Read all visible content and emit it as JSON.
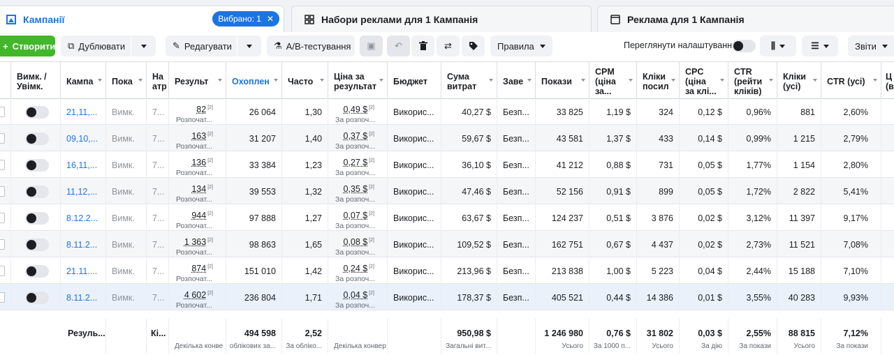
{
  "tabs": {
    "campaigns": "Кампанії",
    "selected_badge": "Вибрано: 1",
    "adsets": "Набори реклами для 1 Кампанія",
    "ads": "Реклама для 1 Кампанія"
  },
  "toolbar": {
    "create": "Створити",
    "duplicate": "Дублювати",
    "edit": "Редагувати",
    "ab_test": "А/В-тестування",
    "rules": "Правила",
    "view_settings": "Переглянути налаштування",
    "reports": "Звіти"
  },
  "columns": [
    "Вимк. / Увімк.",
    "Кампа",
    "Пока",
    "На атр",
    "Результ",
    "Охоплен",
    "Часто",
    "Ціна за результат",
    "Бюджет",
    "Сума витрат",
    "Заве",
    "Покази",
    "CPM (ціна за...",
    "Кліки посил",
    "CPC (ціна за клі...",
    "CTR (рейти кліків)",
    "Кліки (усі)",
    "CTR (усі)",
    "Ц (в"
  ],
  "rows": [
    {
      "name": "21,11,...",
      "delivery": "Вимк.",
      "attr": "7...",
      "result": "82",
      "result_sub": "Розпочат...",
      "reach": "26 064",
      "freq": "1,30",
      "cpr": "0,49 $",
      "cpr_sub": "За розпоч...",
      "budget": "Викорис...",
      "spent": "40,27 $",
      "end": "Безп...",
      "impr": "33 825",
      "cpm": "1,19 $",
      "link": "324",
      "cpc": "0,12 $",
      "ctr": "0,96%",
      "clicks": "881",
      "ctr_all": "2,60%"
    },
    {
      "name": "09,10,...",
      "delivery": "Вимк.",
      "attr": "7...",
      "result": "163",
      "result_sub": "Розпочат...",
      "reach": "31 207",
      "freq": "1,40",
      "cpr": "0,37 $",
      "cpr_sub": "За розпоч...",
      "budget": "Викорис...",
      "spent": "59,67 $",
      "end": "Безп...",
      "impr": "43 581",
      "cpm": "1,37 $",
      "link": "433",
      "cpc": "0,14 $",
      "ctr": "0,99%",
      "clicks": "1 215",
      "ctr_all": "2,79%"
    },
    {
      "name": "16,11,...",
      "delivery": "Вимк.",
      "attr": "7...",
      "result": "136",
      "result_sub": "Розпочат...",
      "reach": "33 384",
      "freq": "1,23",
      "cpr": "0,27 $",
      "cpr_sub": "За розпоч...",
      "budget": "Викорис...",
      "spent": "36,10 $",
      "end": "Безп...",
      "impr": "41 212",
      "cpm": "0,88 $",
      "link": "731",
      "cpc": "0,05 $",
      "ctr": "1,77%",
      "clicks": "1 154",
      "ctr_all": "2,80%"
    },
    {
      "name": "11,12,...",
      "delivery": "Вимк.",
      "attr": "7...",
      "result": "134",
      "result_sub": "Розпочат...",
      "reach": "39 553",
      "freq": "1,32",
      "cpr": "0,35 $",
      "cpr_sub": "За розпоч...",
      "budget": "Викорис...",
      "spent": "47,46 $",
      "end": "Безп...",
      "impr": "52 156",
      "cpm": "0,91 $",
      "link": "899",
      "cpc": "0,05 $",
      "ctr": "1,72%",
      "clicks": "2 822",
      "ctr_all": "5,41%"
    },
    {
      "name": "8.12.2...",
      "delivery": "Вимк.",
      "attr": "7...",
      "result": "944",
      "result_sub": "Розпочат...",
      "reach": "97 888",
      "freq": "1,27",
      "cpr": "0,07 $",
      "cpr_sub": "За розпоч...",
      "budget": "Викорис...",
      "spent": "63,67 $",
      "end": "Безп...",
      "impr": "124 237",
      "cpm": "0,51 $",
      "link": "3 876",
      "cpc": "0,02 $",
      "ctr": "3,12%",
      "clicks": "11 397",
      "ctr_all": "9,17%"
    },
    {
      "name": "8.11.2...",
      "delivery": "Вимк.",
      "attr": "7...",
      "result": "1 363",
      "result_sub": "Розпочат...",
      "reach": "98 863",
      "freq": "1,65",
      "cpr": "0,08 $",
      "cpr_sub": "За розпоч...",
      "budget": "Викорис...",
      "spent": "109,52 $",
      "end": "Безп...",
      "impr": "162 751",
      "cpm": "0,67 $",
      "link": "4 437",
      "cpc": "0,02 $",
      "ctr": "2,73%",
      "clicks": "11 521",
      "ctr_all": "7,08%"
    },
    {
      "name": "21.11....",
      "delivery": "Вимк.",
      "attr": "7...",
      "result": "874",
      "result_sub": "Розпочат...",
      "reach": "151 010",
      "freq": "1,42",
      "cpr": "0,24 $",
      "cpr_sub": "За розпоч...",
      "budget": "Викорис...",
      "spent": "213,96 $",
      "end": "Безп...",
      "impr": "213 838",
      "cpm": "1,00 $",
      "link": "5 223",
      "cpc": "0,04 $",
      "ctr": "2,44%",
      "clicks": "15 188",
      "ctr_all": "7,10%"
    },
    {
      "name": "8.11.2...",
      "delivery": "Вимк.",
      "attr": "7...",
      "result": "4 602",
      "result_sub": "Розпочат...",
      "reach": "236 804",
      "freq": "1,71",
      "cpr": "0,04 $",
      "cpr_sub": "За розпоч...",
      "budget": "Викорис...",
      "spent": "178,37 $",
      "end": "Безп...",
      "impr": "405 521",
      "cpm": "0,44 $",
      "link": "14 386",
      "cpc": "0,01 $",
      "ctr": "3,55%",
      "clicks": "40 283",
      "ctr_all": "9,93%"
    }
  ],
  "totals": {
    "label": "Резуль...",
    "attr": "Кі...",
    "result_sub": "Декілька конве",
    "reach": "494 598",
    "reach_sub": "облікових за...",
    "freq": "2,52",
    "freq_sub": "За обліко...",
    "cpr_sub": "Декілька конвер",
    "spent": "950,98 $",
    "spent_sub": "Загальні вит...",
    "impr": "1 246 980",
    "impr_sub": "Усього",
    "cpm": "0,76 $",
    "cpm_sub": "За 1000 п...",
    "link": "31 802",
    "link_sub": "Усього",
    "cpc": "0,03 $",
    "cpc_sub": "За дію",
    "ctr": "2,55%",
    "ctr_sub": "За покази",
    "clicks": "88 815",
    "clicks_sub": "Усього",
    "ctr_all": "7,12%",
    "ctr_all_sub": "За покази"
  },
  "colors": {
    "accent": "#1b74e4",
    "create": "#42b72a"
  }
}
